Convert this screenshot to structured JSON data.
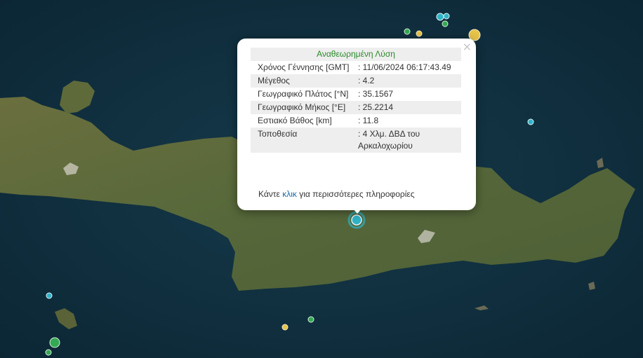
{
  "popup": {
    "header": "Αναθεωρημένη Λύση",
    "close_symbol": "×",
    "rows": [
      {
        "label": "Χρόνος Γέννησης [GMT]",
        "value": ": 11/06/2024 06:17:43.49"
      },
      {
        "label": "Μέγεθος",
        "value": ": 4.2"
      },
      {
        "label": "Γεωγραφικό Πλάτος [°N]",
        "value": ": 35.1567"
      },
      {
        "label": "Γεωγραφικό Μήκος [°E]",
        "value": ": 25.2214"
      },
      {
        "label": "Εστιακό Βάθος [km]",
        "value": ": 11.8"
      },
      {
        "label": "Τοποθεσία",
        "value": ": 4 Χλμ. ΔΒΔ του Αρκαλοχωρίου"
      }
    ],
    "footer_pre": "Κάντε ",
    "footer_link": "κλικ",
    "footer_post": " για περισσότερες πληροφορίες"
  },
  "colors": {
    "sea": "#0d2b3a",
    "land": "#5a6b3a",
    "quake_cyan": "#2fb4c8",
    "quake_green": "#34a853",
    "quake_yellow": "#e6c34a"
  },
  "icons": [
    "earthquake-marker-icon",
    "close-icon"
  ]
}
